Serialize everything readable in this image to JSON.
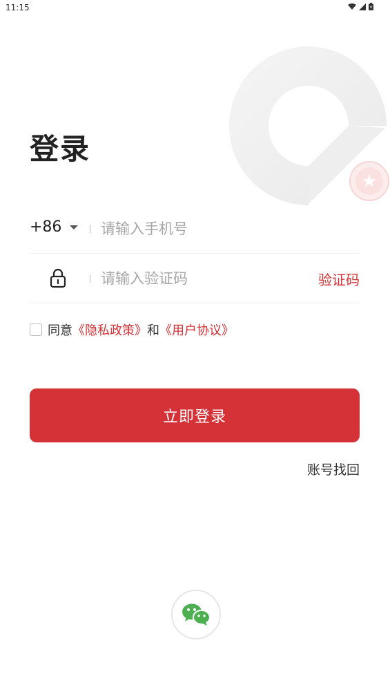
{
  "status_bar": {
    "time": "11:15",
    "icons": [
      "wifi-icon",
      "signal-icon",
      "battery-icon"
    ]
  },
  "title": "登录",
  "phone_row": {
    "country_code": "+86",
    "placeholder": "请输入手机号",
    "value": ""
  },
  "code_row": {
    "placeholder": "请输入验证码",
    "value": "",
    "get_code_label": "验证码",
    "icon": "lock-icon"
  },
  "agreement": {
    "checked": false,
    "prefix": "同意",
    "privacy_link": "《隐私政策》",
    "conjunction": "和",
    "terms_link": "《用户协议》"
  },
  "login_button": "立即登录",
  "recover_account": "账号找回",
  "social_login": {
    "icon": "wechat-icon"
  },
  "colors": {
    "accent": "#d43237",
    "link": "#d73036",
    "placeholder": "#a7a7a7"
  }
}
